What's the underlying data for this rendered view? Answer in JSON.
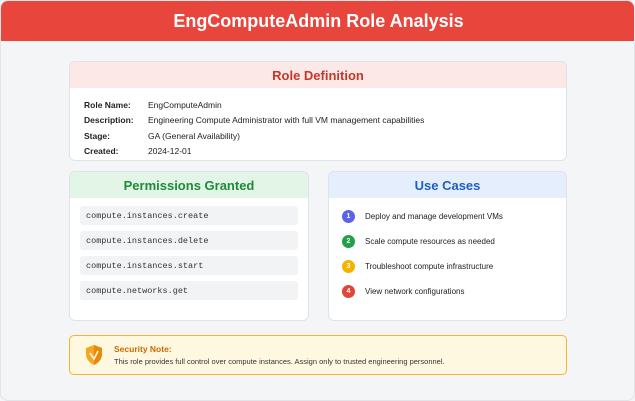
{
  "header": {
    "title": "EngComputeAdmin Role Analysis"
  },
  "colors": {
    "header_bg": "#e8453c",
    "role_accent": "#c0392b",
    "permissions_accent": "#1e8a3a",
    "use_cases_accent": "#1f5fbf",
    "note_accent": "#f2b530"
  },
  "role_definition": {
    "title": "Role Definition",
    "rows": [
      {
        "label": "Role Name:",
        "value": "EngComputeAdmin"
      },
      {
        "label": "Description:",
        "value": "Engineering Compute Administrator with full VM management capabilities"
      },
      {
        "label": "Stage:",
        "value": "GA (General Availability)"
      },
      {
        "label": "Created:",
        "value": "2024-12-01"
      }
    ]
  },
  "permissions": {
    "title": "Permissions Granted",
    "items": [
      "compute.instances.create",
      "compute.instances.delete",
      "compute.instances.start",
      "compute.networks.get"
    ]
  },
  "use_cases": {
    "title": "Use Cases",
    "items": [
      {
        "num": "1",
        "color": "#5b63e6",
        "text": "Deploy and manage development VMs"
      },
      {
        "num": "2",
        "color": "#22a045",
        "text": "Scale compute resources as needed"
      },
      {
        "num": "3",
        "color": "#f2b400",
        "text": "Troubleshoot compute infrastructure"
      },
      {
        "num": "4",
        "color": "#e0443a",
        "text": "View network configurations"
      }
    ]
  },
  "security_note": {
    "icon": "shield-icon",
    "title": "Security Note:",
    "text": "This role provides full control over compute instances. Assign only to trusted engineering personnel."
  }
}
